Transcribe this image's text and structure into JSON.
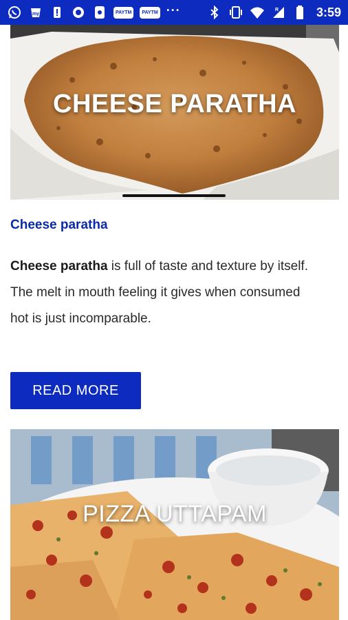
{
  "status_bar": {
    "time": "3:59",
    "tag1": "PAYTM",
    "tag2": "PAYTM",
    "more": "···",
    "left_icons": [
      "whatsapp-icon",
      "app-icon",
      "alert-icon",
      "circle-icon",
      "phone-app-icon",
      "paytm-icon",
      "paytm-icon"
    ],
    "right_icons": [
      "bluetooth-icon",
      "vibrate-icon",
      "wifi-icon",
      "signal-icon",
      "battery-icon"
    ],
    "color": "#0d2bbf"
  },
  "cards": [
    {
      "overlay_title": "CHEESE PARATHA",
      "link_text": "Cheese paratha",
      "description_bold": "Cheese paratha",
      "description_rest": " is full of taste and texture by itself. The melt in mouth feeling it gives when consumed hot is just incomparable.",
      "button_label": "READ MORE"
    },
    {
      "overlay_title": "PIZZA UTTAPAM"
    }
  ],
  "colors": {
    "accent": "#0d2bbf",
    "link": "#0a2aa8"
  }
}
